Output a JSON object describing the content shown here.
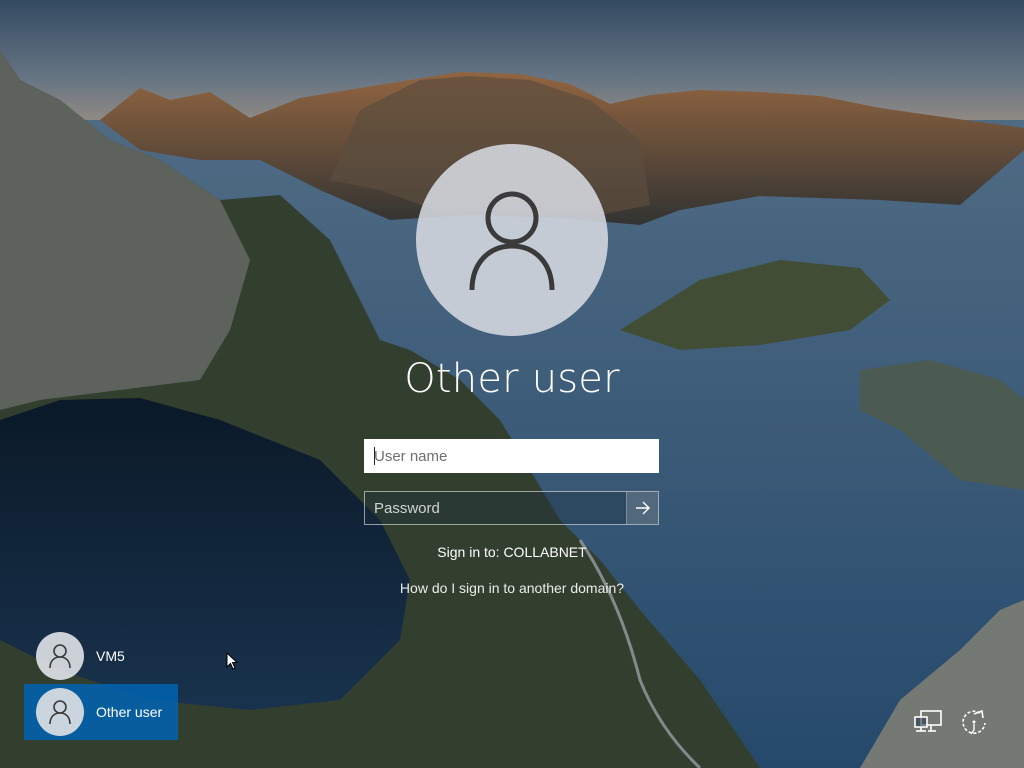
{
  "login": {
    "user_title": "Other user",
    "username_placeholder": "User name",
    "password_placeholder": "Password",
    "sign_in_to": "Sign in to: COLLABNET",
    "other_domain_link": "How do I sign in to another domain?"
  },
  "user_list": [
    {
      "label": "VM5",
      "selected": false
    },
    {
      "label": "Other user",
      "selected": true
    }
  ],
  "corner_icons": [
    "network-icon",
    "ease-of-access-icon"
  ],
  "colors": {
    "selected_tile": "#0063b1",
    "text": "#ffffff"
  }
}
